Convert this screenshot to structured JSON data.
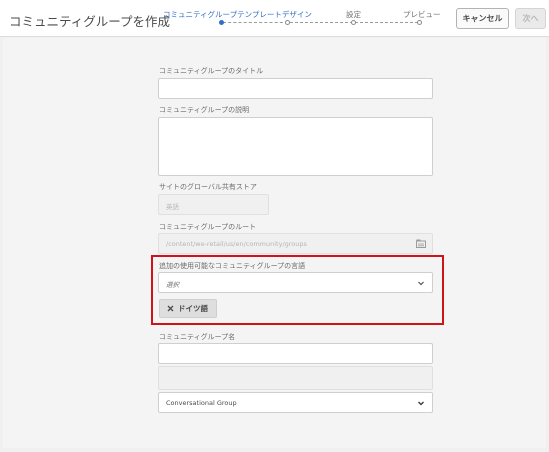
{
  "header": {
    "title": "コミュニティグループを作成",
    "steps": [
      {
        "label": "コミュニティグループテンプレートデザイン",
        "active": true
      },
      {
        "label": "設定",
        "active": false
      },
      {
        "label": "プレビュー",
        "active": false
      }
    ],
    "cancel_label": "キャンセル",
    "next_label": "次へ"
  },
  "form": {
    "title_label": "コミュニティグループのタイトル",
    "title_value": "",
    "description_label": "コミュニティグループの説明",
    "description_value": "",
    "global_store_label": "サイトのグローバル共有ストア",
    "global_store_placeholder": "英語",
    "root_label": "コミュニティグループのルート",
    "root_placeholder": "/content/we-retail/us/en/community/groups",
    "languages_label": "追加の使用可能なコミュニティグループの言語",
    "languages_placeholder": "選択",
    "selected_language_tag": "ドイツ語",
    "name_label": "コミュニティグループ名",
    "name_value": "",
    "template_selected": "Conversational Group"
  },
  "colors": {
    "accent": "#326ec8",
    "highlight": "#d0121b"
  },
  "icons": {
    "browse": "folder-browse-icon",
    "dropdown": "chevron-down-icon",
    "remove": "close-icon"
  }
}
